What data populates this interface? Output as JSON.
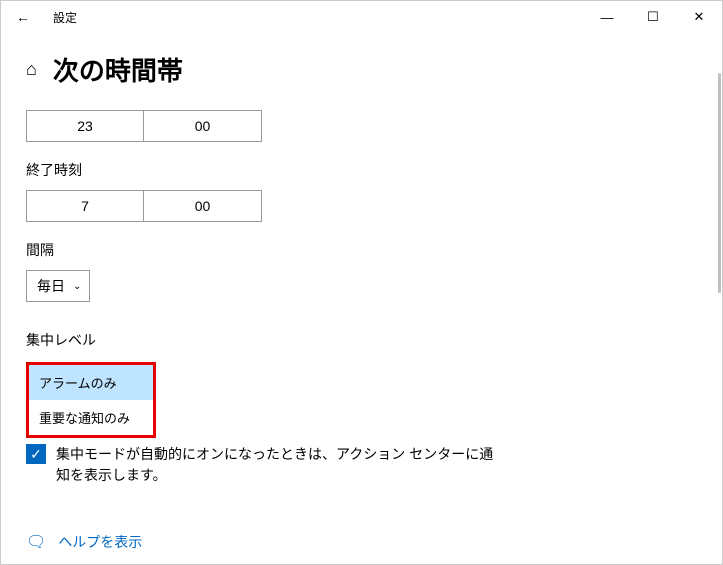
{
  "titlebar": {
    "back_icon": "←",
    "title": "設定",
    "min_icon": "―",
    "max_icon": "☐",
    "close_icon": "✕"
  },
  "header": {
    "home_icon": "⌂",
    "title": "次の時間帯"
  },
  "start_time": {
    "hour": "23",
    "minute": "00"
  },
  "end_label": "終了時刻",
  "end_time": {
    "hour": "7",
    "minute": "00"
  },
  "interval": {
    "label": "間隔",
    "value": "毎日",
    "chevron": "⌄"
  },
  "focus_level": {
    "label": "集中レベル",
    "options": {
      "alarms": "アラームのみ",
      "priority": "重要な通知のみ"
    }
  },
  "checkbox": {
    "check": "✓",
    "text": "集中モードが自動的にオンになったときは、アクション センターに通知を表示します。"
  },
  "help": {
    "icon": "🗨",
    "text": "ヘルプを表示"
  }
}
